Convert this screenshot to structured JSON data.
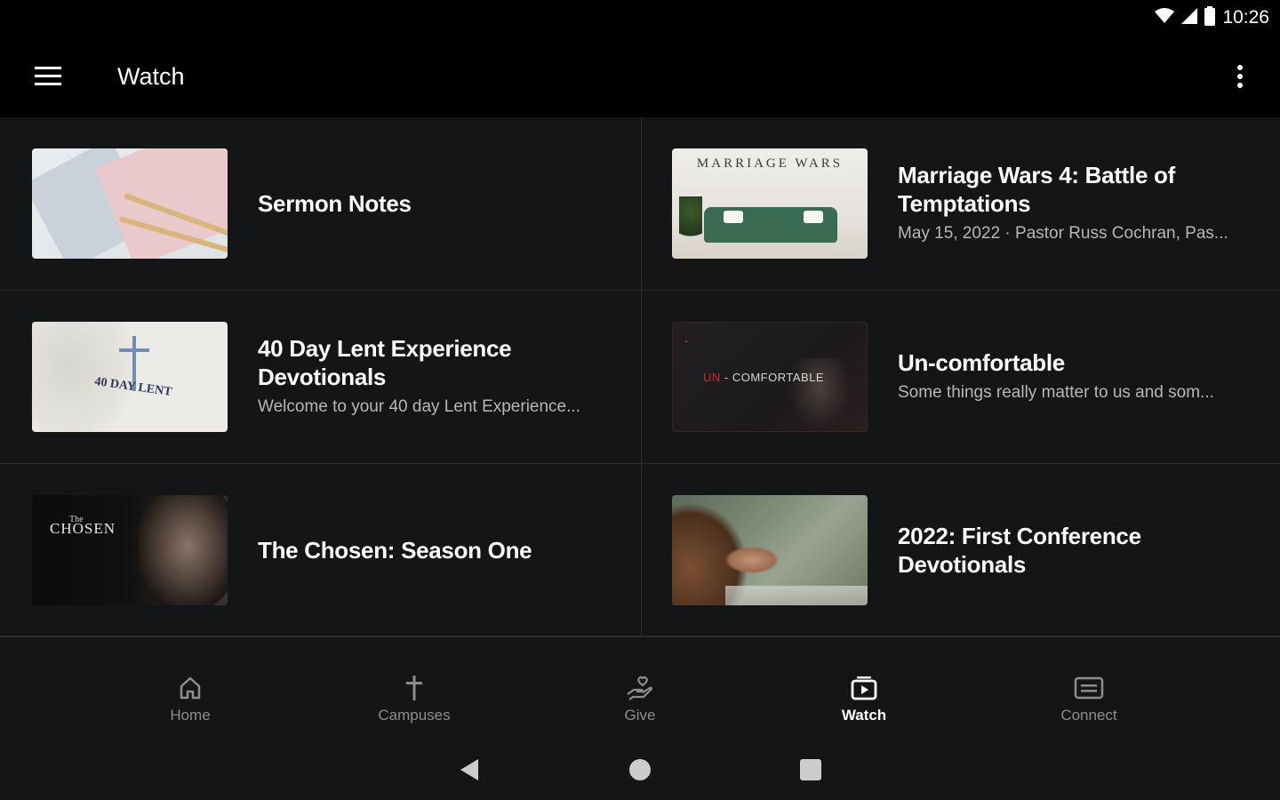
{
  "status_bar": {
    "time": "10:26"
  },
  "app_bar": {
    "title": "Watch"
  },
  "items": [
    {
      "title": "Sermon Notes",
      "subtitle": ""
    },
    {
      "title": "Marriage Wars 4: Battle of Temptations",
      "subtitle": "May 15, 2022 · Pastor Russ Cochran, Pas..."
    },
    {
      "title": "40 Day Lent Experience Devotionals",
      "subtitle": "Welcome to your 40 day Lent Experience..."
    },
    {
      "title": "Un-comfortable",
      "subtitle": "Some things really matter to us and som..."
    },
    {
      "title": "The Chosen: Season One",
      "subtitle": ""
    },
    {
      "title": "2022: First Conference Devotionals",
      "subtitle": ""
    }
  ],
  "thumbnails": {
    "marriage_wars_text": "MARRIAGE WARS",
    "lent_text": "40 DAY LENT",
    "uncomfortable_prefix": "UN",
    "uncomfortable_rest": "- COMFORTABLE",
    "chosen_small": "The",
    "chosen_title": "CHOSEN"
  },
  "bottom_nav": {
    "active": "Watch",
    "items": [
      {
        "label": "Home",
        "icon": "home-icon"
      },
      {
        "label": "Campuses",
        "icon": "cross-icon"
      },
      {
        "label": "Give",
        "icon": "give-hand-heart-icon"
      },
      {
        "label": "Watch",
        "icon": "watch-play-icon"
      },
      {
        "label": "Connect",
        "icon": "connect-card-icon"
      }
    ]
  },
  "colors": {
    "background": "#000000",
    "surface": "#141517",
    "divider": "#2a2b2e",
    "text_primary": "#ffffff",
    "text_secondary": "#b5b7bb",
    "nav_inactive": "#8b8d91"
  }
}
